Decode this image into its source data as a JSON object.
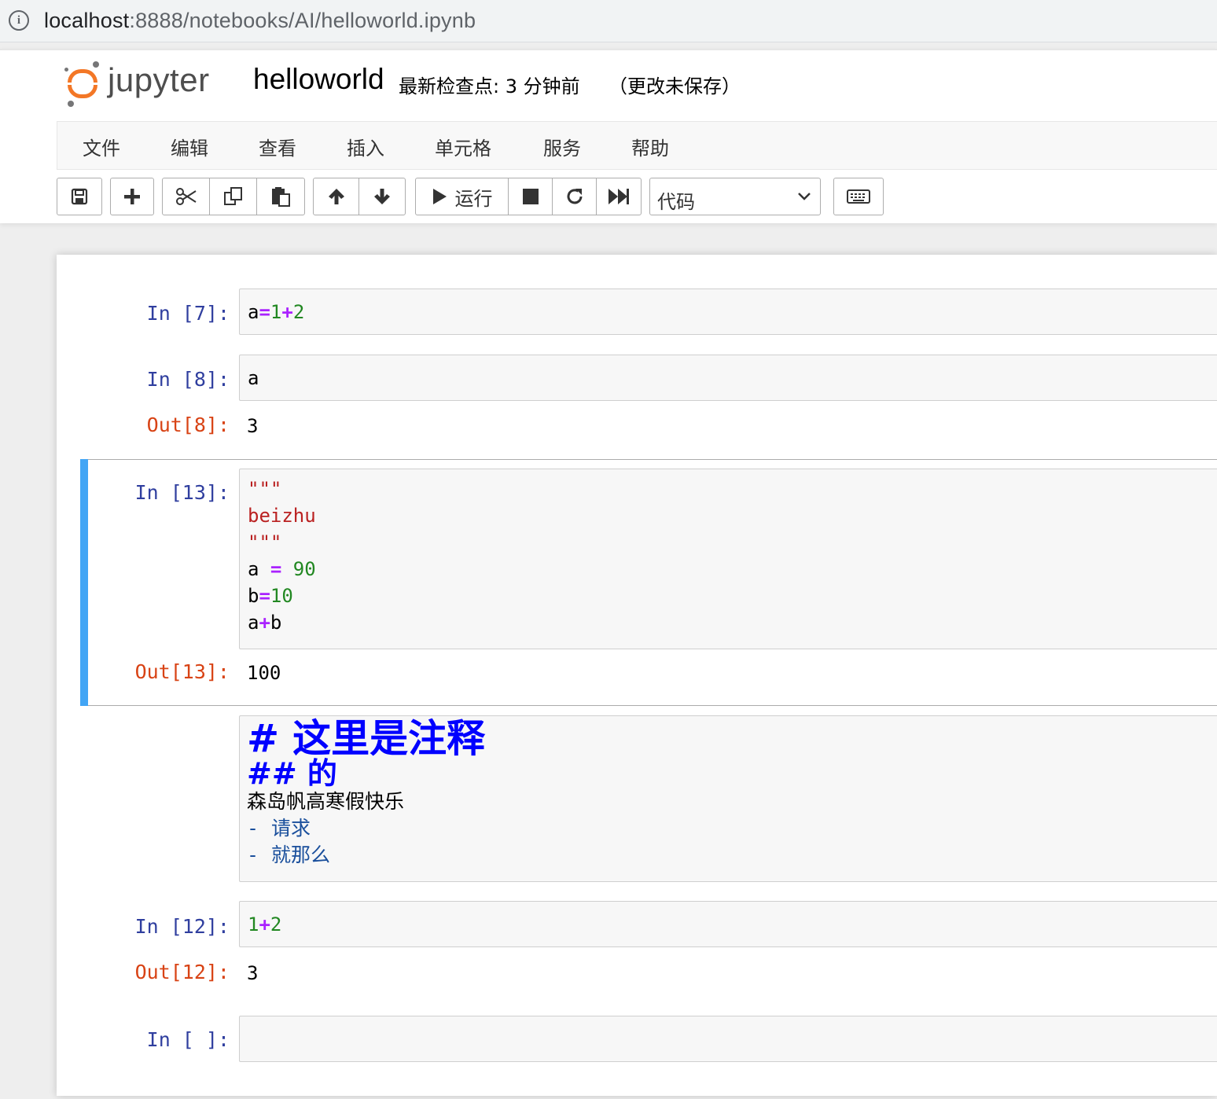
{
  "browser": {
    "url_host": "localhost",
    "url_rest": ":8888/notebooks/AI/helloworld.ipynb"
  },
  "header": {
    "logo_text": "jupyter",
    "notebook_title": "helloworld",
    "checkpoint": "最新检查点: 3 分钟前",
    "autosave_status": "（更改未保存）"
  },
  "menu": {
    "items": [
      "文件",
      "编辑",
      "查看",
      "插入",
      "单元格",
      "服务",
      "帮助"
    ]
  },
  "toolbar": {
    "run_label": "运行",
    "cell_type": "代码",
    "icons": [
      "save-icon",
      "plus-icon",
      "cut-icon",
      "copy-icon",
      "paste-icon",
      "arrow-up-icon",
      "arrow-down-icon",
      "run-icon",
      "stop-icon",
      "restart-icon",
      "fast-forward-icon",
      "keyboard-icon"
    ]
  },
  "cells": {
    "c1": {
      "in_prompt": "In [7]:",
      "code": [
        "a=1+2"
      ]
    },
    "c2": {
      "in_prompt": "In [8]:",
      "code": [
        "a"
      ],
      "out_prompt": "Out[8]:",
      "output": "3"
    },
    "c3": {
      "in_prompt": "In [13]:",
      "code": [
        "\"\"\"",
        "beizhu",
        "\"\"\"",
        "a = 90",
        "b=10",
        "a+b"
      ],
      "out_prompt": "Out[13]:",
      "output": "100"
    },
    "c4": {
      "markdown": {
        "h1": "# 这里是注释",
        "h2": "## 的",
        "p": "森岛帆高寒假快乐",
        "li1_dash": "-",
        "li1": "请求",
        "li2_dash": "-",
        "li2": "就那么"
      }
    },
    "c5": {
      "in_prompt": "In [12]:",
      "code": [
        "1+2"
      ],
      "out_prompt": "Out[12]:",
      "output": "3"
    },
    "c6": {
      "in_prompt": "In [ ]:",
      "code": []
    }
  },
  "colors": {
    "selected_bar": "#42a5f5",
    "in_prompt": "#303f9f",
    "out_prompt": "#d84315",
    "logo_orange": "#f37726"
  }
}
